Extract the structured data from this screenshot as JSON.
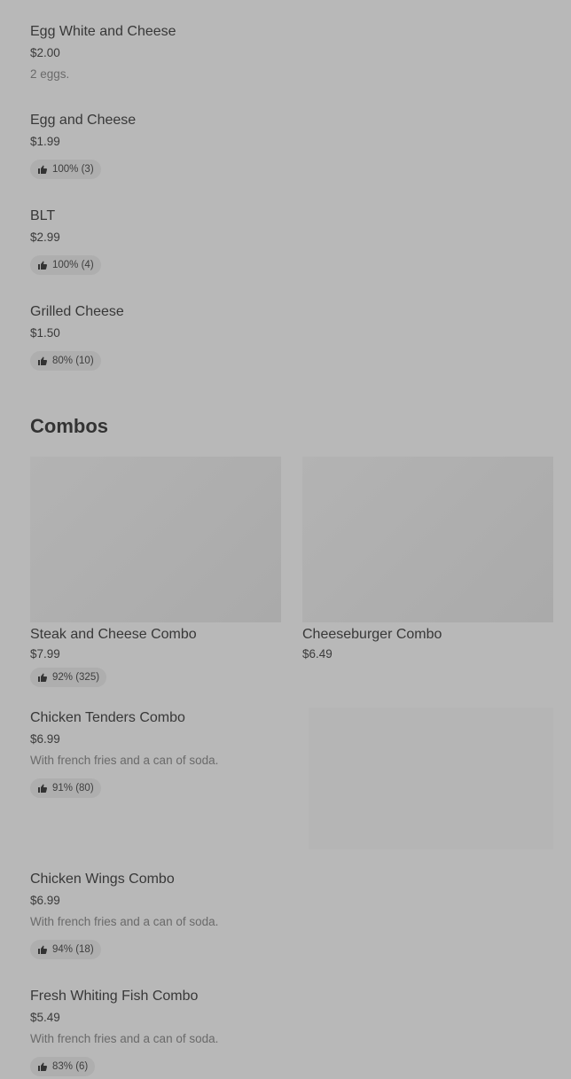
{
  "items": [
    {
      "name": "Egg White and Cheese",
      "price": "$2.00",
      "desc": "2 eggs."
    },
    {
      "name": "Egg and Cheese",
      "price": "$1.99",
      "rating": "100% (3)"
    },
    {
      "name": "BLT",
      "price": "$2.99",
      "rating": "100% (4)"
    },
    {
      "name": "Grilled Cheese",
      "price": "$1.50",
      "rating": "80% (10)"
    }
  ],
  "combos_title": "Combos",
  "combos": [
    {
      "name": "Steak and Cheese Combo",
      "price": "$7.99",
      "rating": "92% (325)"
    },
    {
      "name": "Cheeseburger Combo",
      "price": "$6.49"
    },
    {
      "name": "Chicken Tenders Combo",
      "price": "$6.99",
      "desc": "With french fries and a can of soda.",
      "rating": "91% (80)"
    },
    {
      "name": "Chicken Wings Combo",
      "price": "$6.99",
      "desc": "With french fries and a can of soda.",
      "rating": "94% (18)"
    },
    {
      "name": "Fresh Whiting Fish Combo",
      "price": "$5.49",
      "desc": "With french fries and a can of soda.",
      "rating": "83% (6)"
    }
  ],
  "icons": {
    "rating": "thumbs-up-icon"
  }
}
